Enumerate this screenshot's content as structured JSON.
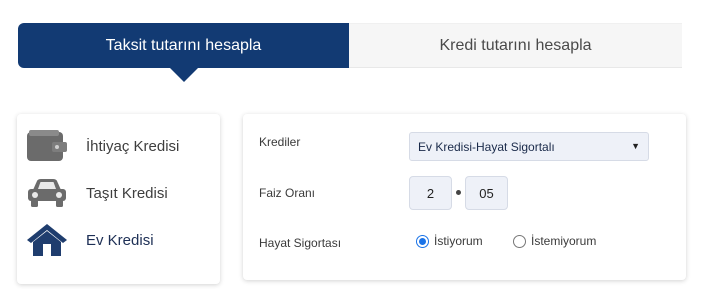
{
  "tabs": {
    "installment": "Taksit tutarını hesapla",
    "loan_amount": "Kredi tutarını hesapla"
  },
  "loan_types": [
    {
      "label": "İhtiyaç Kredisi",
      "icon": "wallet-icon"
    },
    {
      "label": "Taşıt Kredisi",
      "icon": "car-icon"
    },
    {
      "label": "Ev Kredisi",
      "icon": "house-icon",
      "selected": true
    }
  ],
  "form": {
    "credits_label": "Krediler",
    "credits_value": "Ev Kredisi-Hayat Sigortalı",
    "rate_label": "Faiz Oranı",
    "rate_whole": "2",
    "rate_decimal": "05",
    "insurance_label": "Hayat Sigortası",
    "insurance_yes": "İstiyorum",
    "insurance_no": "İstemiyorum",
    "insurance_selected": "İstiyorum"
  },
  "colors": {
    "primary": "#123a73",
    "radio": "#1a73e8"
  }
}
